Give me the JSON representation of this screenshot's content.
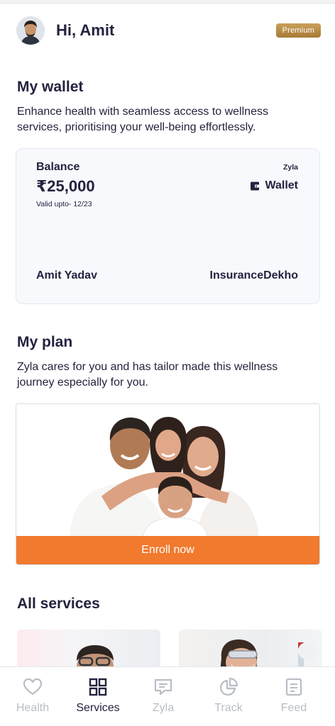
{
  "header": {
    "greeting": "Hi, Amit",
    "badge": "Premium"
  },
  "wallet_section": {
    "title": "My wallet",
    "description": "Enhance health with seamless access to wellness services, prioritising your well-being effortlessly."
  },
  "wallet_card": {
    "balance_label": "Balance",
    "balance_value": "₹25,000",
    "valid_upto": "Valid upto- 12/23",
    "brand": "Zyla",
    "wallet_label": "Wallet",
    "holder_name": "Amit Yadav",
    "insurer": "InsuranceDekho"
  },
  "plan_section": {
    "title": "My plan",
    "description": "Zyla cares for you and has tailor made this wellness journey especially for you.",
    "cta": "Enroll now"
  },
  "services_section": {
    "title": "All services"
  },
  "bottom_nav": {
    "items": [
      {
        "label": "Health",
        "icon": "heart-icon"
      },
      {
        "label": "Services",
        "icon": "grid-icon"
      },
      {
        "label": "Zyla",
        "icon": "chat-icon"
      },
      {
        "label": "Track",
        "icon": "pie-chart-icon"
      },
      {
        "label": "Feed",
        "icon": "document-icon"
      }
    ],
    "active": "Services"
  },
  "colors": {
    "text_primary": "#23233f",
    "accent_orange": "#f17a2e",
    "premium_gold": "#b8873f",
    "nav_inactive": "#b9bdc6"
  }
}
